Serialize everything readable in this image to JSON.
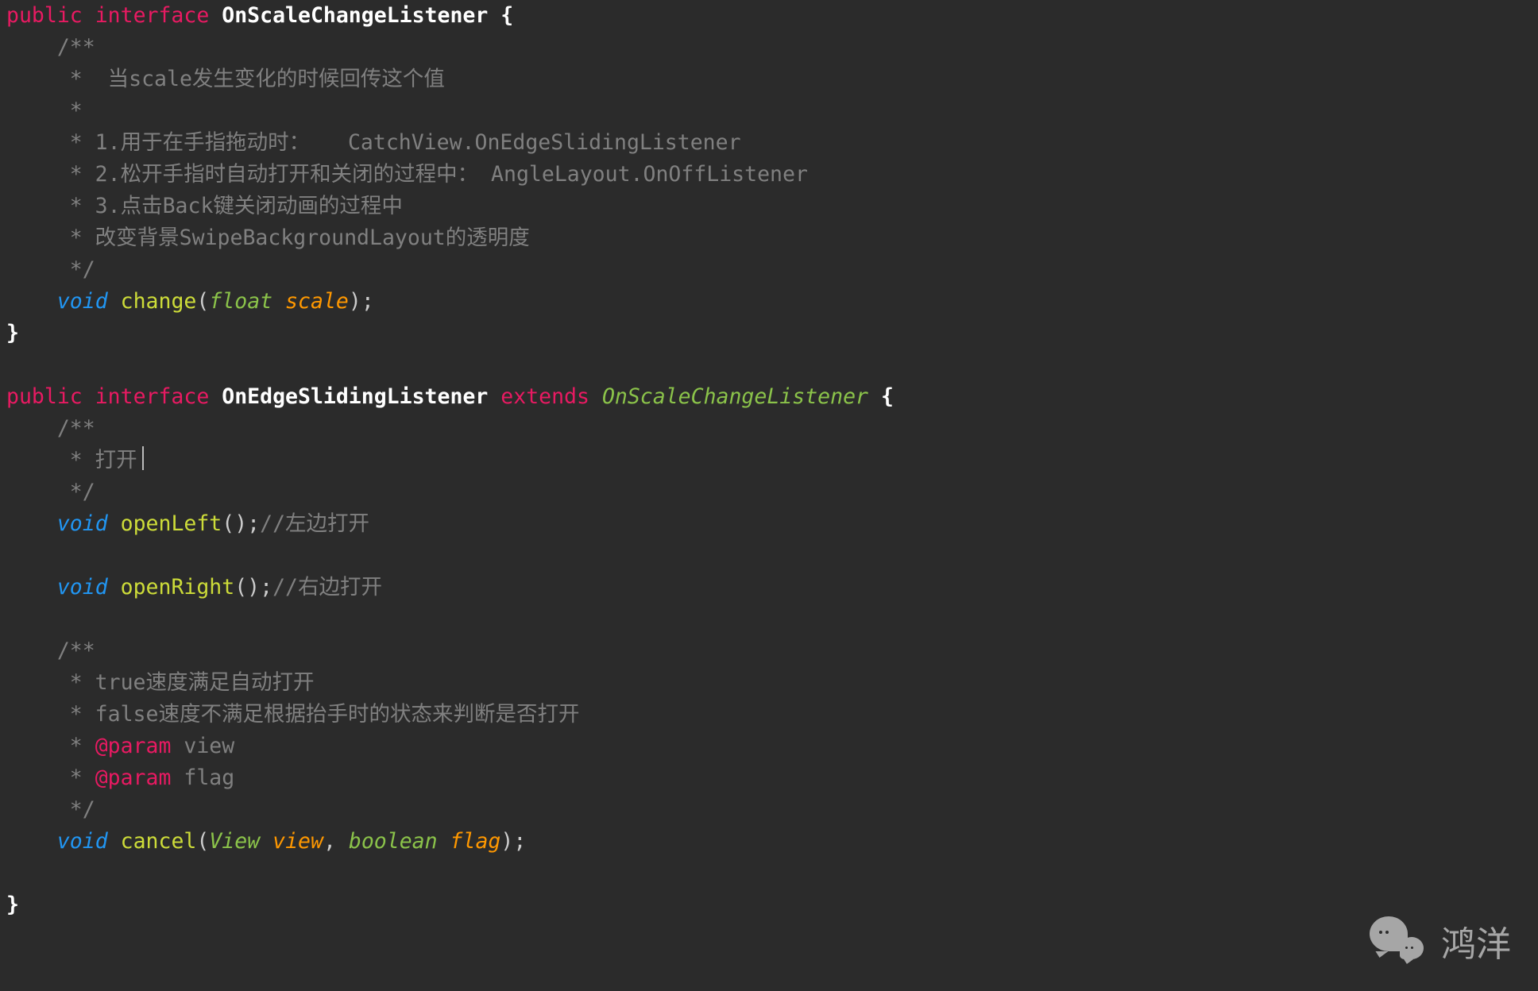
{
  "code": {
    "l1": {
      "public": "public",
      "interface": "interface",
      "name": "OnScaleChangeListener",
      "open": "{"
    },
    "l2": "    /**",
    "l3": "     *  当scale发生变化的时候回传这个值",
    "l4": "     *",
    "l5": "     * 1.用于在手指拖动时：   CatchView.OnEdgeSlidingListener",
    "l6": "     * 2.松开手指时自动打开和关闭的过程中： AngleLayout.OnOffListener",
    "l7": "     * 3.点击Back键关闭动画的过程中",
    "l8": "     * 改变背景SwipeBackgroundLayout的透明度",
    "l9": "     */",
    "l10": {
      "void": "void",
      "name": "change",
      "op": "(",
      "t": "float",
      "p": "scale",
      "cp": ");"
    },
    "l11": "}",
    "l12": "",
    "l13": {
      "public": "public",
      "interface": "interface",
      "name": "OnEdgeSlidingListener",
      "extends": "extends",
      "sup": "OnScaleChangeListener",
      "open": "{"
    },
    "l14": "    /**",
    "l15": "     * 打开",
    "l16": "     */",
    "l17": {
      "void": "void",
      "name": "openLeft",
      "cp": "();",
      "cmt": "//左边打开"
    },
    "l18": "",
    "l19": {
      "void": "void",
      "name": "openRight",
      "cp": "();",
      "cmt": "//右边打开"
    },
    "l20": "",
    "l21": "    /**",
    "l22": "     * true速度满足自动打开",
    "l23": "     * false速度不满足根据抬手时的状态来判断是否打开",
    "l24": {
      "pre": "     * ",
      "tag": "@param",
      "rest": " view"
    },
    "l25": {
      "pre": "     * ",
      "tag": "@param",
      "rest": " flag"
    },
    "l26": "     */",
    "l27": {
      "void": "void",
      "name": "cancel",
      "op": "(",
      "t1": "View",
      "p1": "view",
      "comma": ", ",
      "t2": "boolean",
      "p2": "flag",
      "cp": ");"
    },
    "l28": "",
    "l29": "}"
  },
  "watermark": "鸿洋"
}
